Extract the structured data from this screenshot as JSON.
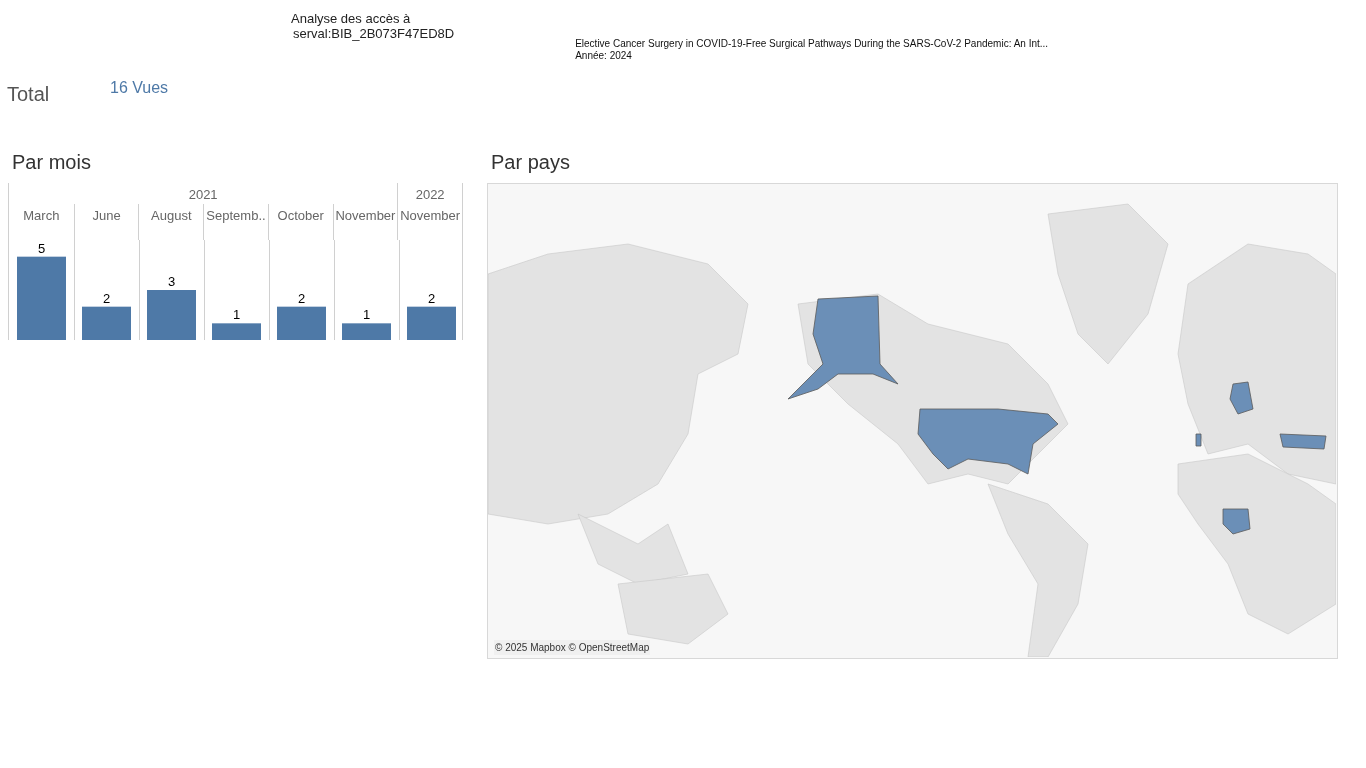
{
  "header": {
    "title": "Analyse des accès à",
    "identifier": "serval:BIB_2B073F47ED8D",
    "article_title": "Elective Cancer Surgery in COVID-19-Free Surgical Pathways During the SARS-CoV-2 Pandemic: An Int...",
    "year": "Année: 2024"
  },
  "total": {
    "label": "Total",
    "value": "16 Vues"
  },
  "par_mois": {
    "title": "Par mois",
    "years": [
      {
        "label": "2021"
      },
      {
        "label": "2022"
      }
    ],
    "chart_data": {
      "type": "bar",
      "categories": [
        "March",
        "June",
        "August",
        "Septemb..",
        "October",
        "November",
        "November"
      ],
      "values": [
        5,
        2,
        3,
        1,
        2,
        1,
        2
      ],
      "ylim": [
        0,
        6
      ],
      "data_labels": true
    }
  },
  "par_pays": {
    "title": "Par pays",
    "attribution": "© 2025 Mapbox © OpenStreetMap"
  }
}
